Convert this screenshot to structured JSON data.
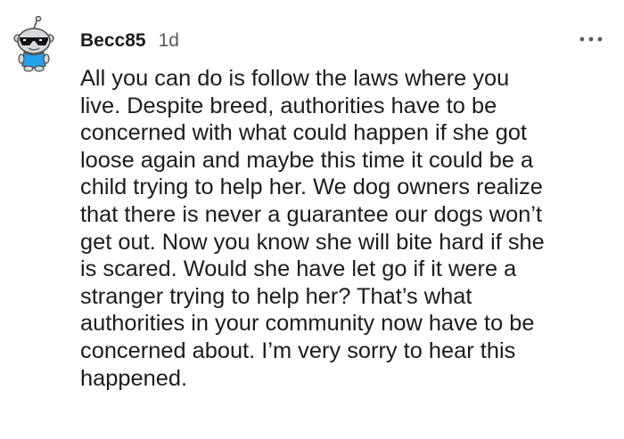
{
  "comment": {
    "username": "Becc85",
    "timestamp": "1d",
    "more_icon": "more-horizontal-icon",
    "avatar_icon": "snoo-avatar-with-sunglasses",
    "body_lines": [
      "All you can do is follow the laws where you",
      "live. Despite breed, authorities have to be",
      "concerned with what could happen if she got",
      "loose again and maybe this time it could be a",
      "child trying to help her. We dog owners realize",
      "that there is never a guarantee our dogs won’t",
      "get out. Now you know she will bite hard if she",
      "is scared. Would she have let go if it were a",
      "stranger trying to help her? That’s what",
      "authorities in your community now have to be",
      "concerned about. I’m very sorry to hear this",
      "happened."
    ]
  },
  "colors": {
    "text": "#1c1c1c",
    "muted": "#5a5a5a",
    "avatar_body": "#d7dadc",
    "avatar_outline": "#4a4a4a",
    "avatar_shirt": "#24a0ed"
  }
}
